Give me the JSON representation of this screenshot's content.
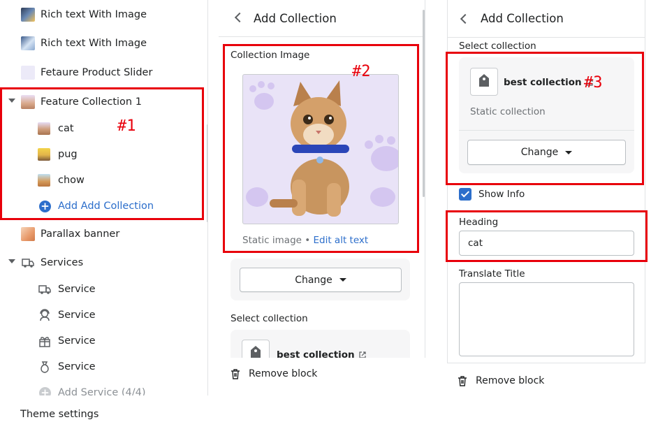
{
  "left_panel": {
    "items": [
      {
        "label": "Rich text With Image"
      },
      {
        "label": "Rich text With Image"
      },
      {
        "label": "Fetaure Product Slider"
      },
      {
        "label": "Feature Collection 1"
      },
      {
        "label": "Parallax banner"
      },
      {
        "label": "Services"
      }
    ],
    "collections": [
      {
        "label": "cat"
      },
      {
        "label": "pug"
      },
      {
        "label": "chow"
      }
    ],
    "add_collection_label": "Add Add Collection",
    "services": [
      {
        "label": "Service",
        "icon": "truck-icon"
      },
      {
        "label": "Service",
        "icon": "support-agent-icon"
      },
      {
        "label": "Service",
        "icon": "gift-icon"
      },
      {
        "label": "Service",
        "icon": "money-bag-icon"
      }
    ],
    "add_service_label": "Add Service (4/4)",
    "theme_settings_label": "Theme settings"
  },
  "middle_panel": {
    "title": "Add Collection",
    "image_label": "Collection Image",
    "image_caption": "Static image",
    "image_caption_sep": " • ",
    "edit_alt_text_label": "Edit alt text",
    "change_button_label": "Change",
    "select_collection_label": "Select collection",
    "collection_name": "best collection",
    "remove_block_label": "Remove block"
  },
  "right_panel": {
    "title": "Add Collection",
    "select_collection_label": "Select collection",
    "collection_name": "best collection",
    "collection_type": "Static collection",
    "change_button_label": "Change",
    "show_info_label": "Show Info",
    "show_info_checked": true,
    "heading_label": "Heading",
    "heading_value": "cat",
    "translate_title_label": "Translate Title",
    "translate_title_value": "",
    "remove_block_label": "Remove block"
  },
  "annotations": [
    {
      "tag": "#1"
    },
    {
      "tag": "#2"
    },
    {
      "tag": "#3"
    }
  ],
  "colors": {
    "accent": "#2c6ecb",
    "annotation": "#e8000b",
    "text": "#202223",
    "muted": "#6d7175"
  }
}
